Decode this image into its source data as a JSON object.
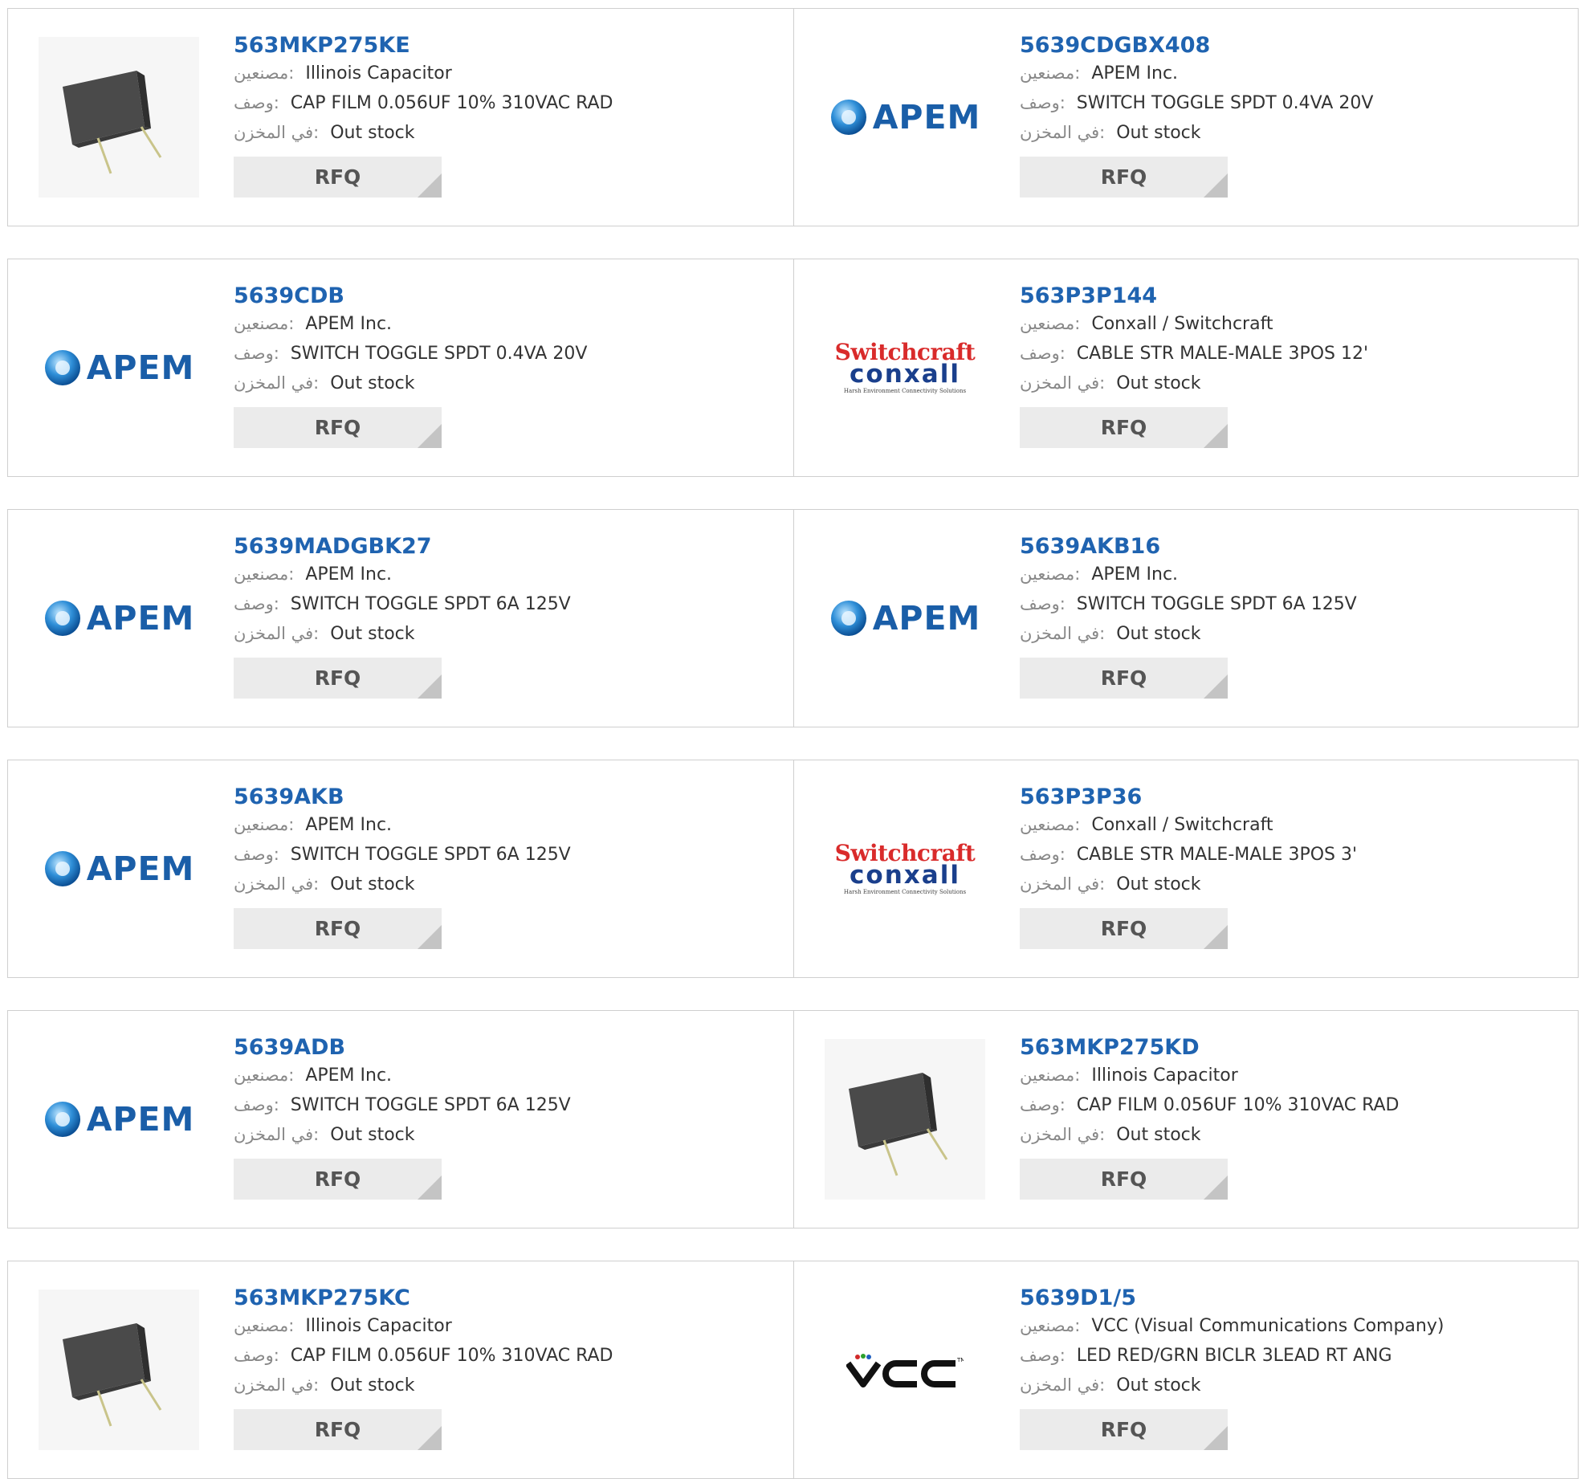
{
  "labels": {
    "manufacturer": "مصنعين:",
    "description": "وصف:",
    "stock": "في المخزن:",
    "rfq": "RFQ"
  },
  "products": [
    {
      "part": "563MKP275KE",
      "manufacturer": "Illinois Capacitor",
      "description": "CAP FILM 0.056UF 10% 310VAC RAD",
      "stock": "Out stock",
      "image": "capacitor"
    },
    {
      "part": "5639CDGBX408",
      "manufacturer": "APEM Inc.",
      "description": "SWITCH TOGGLE SPDT 0.4VA 20V",
      "stock": "Out stock",
      "image": "apem-logo"
    },
    {
      "part": "5639CDB",
      "manufacturer": "APEM Inc.",
      "description": "SWITCH TOGGLE SPDT 0.4VA 20V",
      "stock": "Out stock",
      "image": "apem-logo"
    },
    {
      "part": "563P3P144",
      "manufacturer": "Conxall / Switchcraft",
      "description": "CABLE STR MALE-MALE 3POS 12'",
      "stock": "Out stock",
      "image": "switchcraft-logo"
    },
    {
      "part": "5639MADGBK27",
      "manufacturer": "APEM Inc.",
      "description": "SWITCH TOGGLE SPDT 6A 125V",
      "stock": "Out stock",
      "image": "apem-logo"
    },
    {
      "part": "5639AKB16",
      "manufacturer": "APEM Inc.",
      "description": "SWITCH TOGGLE SPDT 6A 125V",
      "stock": "Out stock",
      "image": "apem-logo"
    },
    {
      "part": "5639AKB",
      "manufacturer": "APEM Inc.",
      "description": "SWITCH TOGGLE SPDT 6A 125V",
      "stock": "Out stock",
      "image": "apem-logo"
    },
    {
      "part": "563P3P36",
      "manufacturer": "Conxall / Switchcraft",
      "description": "CABLE STR MALE-MALE 3POS 3'",
      "stock": "Out stock",
      "image": "switchcraft-logo"
    },
    {
      "part": "5639ADB",
      "manufacturer": "APEM Inc.",
      "description": "SWITCH TOGGLE SPDT 6A 125V",
      "stock": "Out stock",
      "image": "apem-logo"
    },
    {
      "part": "563MKP275KD",
      "manufacturer": "Illinois Capacitor",
      "description": "CAP FILM 0.056UF 10% 310VAC RAD",
      "stock": "Out stock",
      "image": "capacitor"
    },
    {
      "part": "563MKP275KC",
      "manufacturer": "Illinois Capacitor",
      "description": "CAP FILM 0.056UF 10% 310VAC RAD",
      "stock": "Out stock",
      "image": "capacitor"
    },
    {
      "part": "5639D1/5",
      "manufacturer": "VCC (Visual Communications Company)",
      "description": "LED RED/GRN BICLR 3LEAD RT ANG",
      "stock": "Out stock",
      "image": "vcc-logo"
    }
  ],
  "logos": {
    "apem": "APEM",
    "switchcraft_top": "Switchcraft",
    "switchcraft_bottom": "conxall",
    "switchcraft_tagline": "Harsh Environment Connectivity Solutions",
    "vcc": "VCC"
  }
}
